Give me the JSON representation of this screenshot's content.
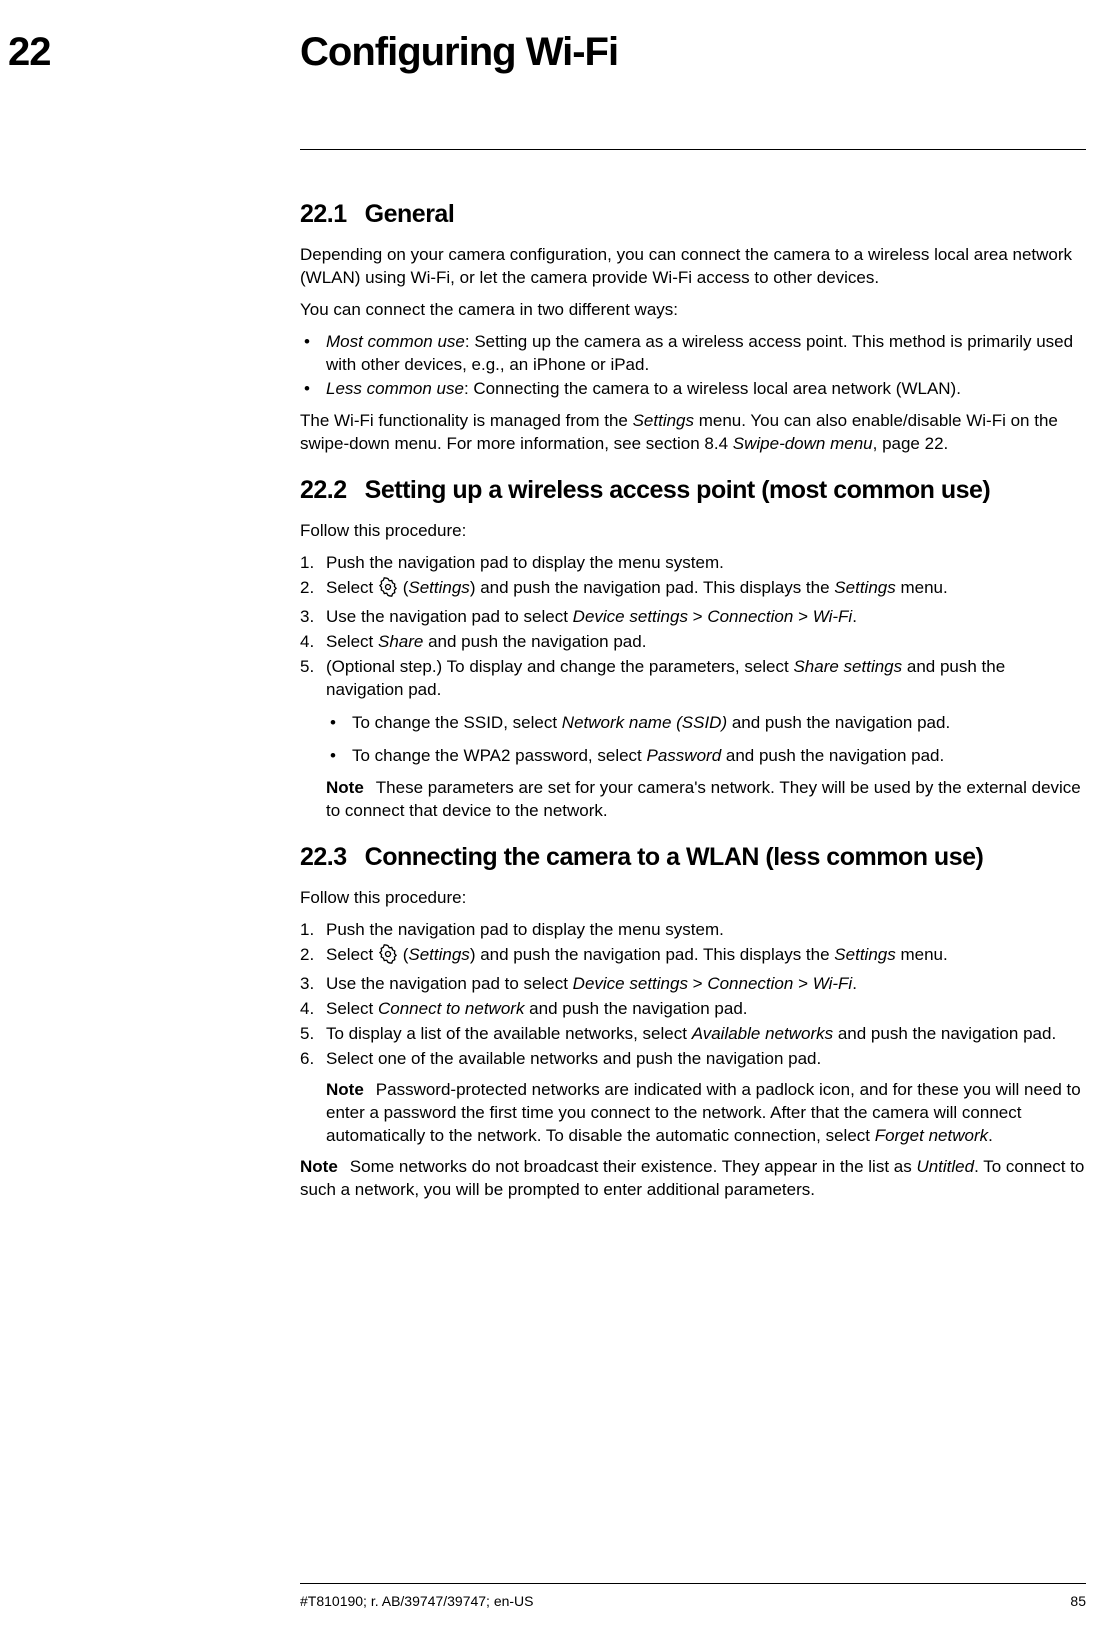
{
  "chapter": {
    "number": "22",
    "title": "Configuring Wi-Fi"
  },
  "s1": {
    "num": "22.1",
    "title": "General",
    "p1": "Depending on your camera configuration, you can connect the camera to a wireless local area network (WLAN) using Wi-Fi, or let the camera provide Wi-Fi access to other devices.",
    "p2": "You can connect the camera in two different ways:",
    "li1_em": "Most common use",
    "li1_rest": ": Setting up the camera as a wireless access point. This method is primarily used with other devices, e.g., an iPhone or iPad.",
    "li2_em": "Less common use",
    "li2_rest": ": Connecting the camera to a wireless local area network (WLAN).",
    "p3a": "The Wi-Fi functionality is managed from the ",
    "p3b": "Settings",
    "p3c": " menu. You can also enable/disable Wi-Fi on the swipe-down menu. For more information, see section 8.4 ",
    "p3d": "Swipe-down menu",
    "p3e": ", page 22."
  },
  "s2": {
    "num": "22.2",
    "title": "Setting up a wireless access point (most common use)",
    "intro": "Follow this procedure:",
    "li1": "Push the navigation pad to display the menu system.",
    "li2a": "Select ",
    "li2b": " (",
    "li2c": "Settings",
    "li2d": ") and push the navigation pad. This displays the ",
    "li2e": "Settings",
    "li2f": " menu.",
    "li3a": "Use the navigation pad to select ",
    "li3b": "Device settings",
    "li3c": " > ",
    "li3d": "Connection",
    "li3e": " > ",
    "li3f": "Wi-Fi",
    "li3g": ".",
    "li4a": "Select ",
    "li4b": "Share",
    "li4c": " and push the navigation pad.",
    "li5a": "(Optional step.) To display and change the parameters, select ",
    "li5b": "Share settings",
    "li5c": " and push the navigation pad.",
    "sub1a": "To change the SSID, select ",
    "sub1b": "Network name (SSID)",
    "sub1c": " and push the navigation pad.",
    "sub2a": "To change the WPA2 password, select ",
    "sub2b": "Password",
    "sub2c": " and push the navigation pad.",
    "note_label": "Note",
    "note_text": "These parameters are set for your camera's network. They will be used by the external device to connect that device to the network."
  },
  "s3": {
    "num": "22.3",
    "title": "Connecting the camera to a WLAN (less common use)",
    "intro": "Follow this procedure:",
    "li1": "Push the navigation pad to display the menu system.",
    "li2a": "Select ",
    "li2b": " (",
    "li2c": "Settings",
    "li2d": ") and push the navigation pad. This displays the ",
    "li2e": "Settings",
    "li2f": " menu.",
    "li3a": "Use the navigation pad to select ",
    "li3b": "Device settings",
    "li3c": " > ",
    "li3d": "Connection",
    "li3e": " > ",
    "li3f": "Wi-Fi",
    "li3g": ".",
    "li4a": "Select ",
    "li4b": "Connect to network",
    "li4c": " and push the navigation pad.",
    "li5a": "To display a list of the available networks, select ",
    "li5b": "Available networks",
    "li5c": " and push the navigation pad.",
    "li6": "Select one of the available networks and push the navigation pad.",
    "note_label": "Note",
    "note_text_a": "Password-protected networks are indicated with a padlock icon, and for these you will need to enter a password the first time you connect to the network. After that the camera will connect automatically to the network. To disable the automatic connection, select ",
    "note_text_b": "Forget network",
    "note_text_c": ".",
    "outer_note_label": "Note",
    "outer_note_a": "Some networks do not broadcast their existence. They appear in the list as ",
    "outer_note_b": "Untitled",
    "outer_note_c": ". To connect to such a network, you will be prompted to enter additional parameters."
  },
  "footer": {
    "left": "#T810190; r. AB/39747/39747; en-US",
    "right": "85"
  }
}
